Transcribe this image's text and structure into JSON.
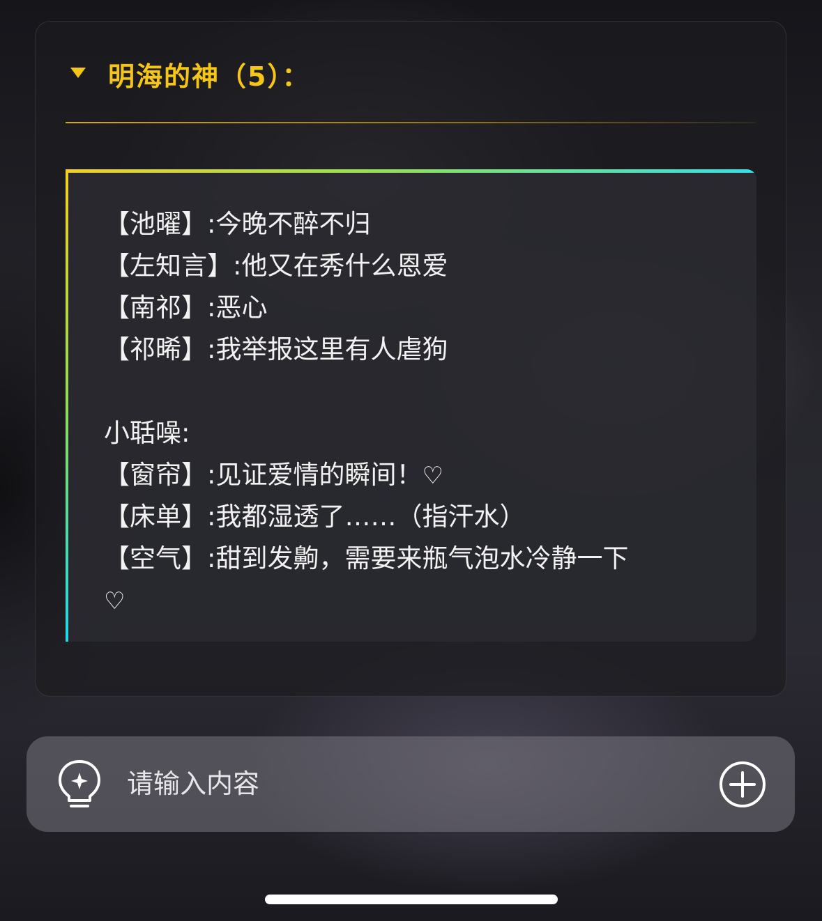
{
  "header": {
    "title": "明海的神（5）："
  },
  "messages": [
    "【池曜】:今晚不醉不归",
    "【左知言】:他又在秀什么恩爱",
    "【南祁】:恶心",
    "【祁晞】:我举报这里有人虐狗",
    "",
    "小聒噪:",
    "【窗帘】:见证爱情的瞬间！",
    "【床单】:我都湿透了……（指汗水）",
    "【空气】:甜到发齁，需要来瓶气泡水冷静一下"
  ],
  "icons": {
    "heart": "♡",
    "caret": "caret-down-icon",
    "bulb": "lightbulb-icon",
    "plus": "plus-circle-icon"
  },
  "input": {
    "placeholder": "请输入内容"
  },
  "colors": {
    "accent": "#f5c518",
    "gradient_start": "#f3cf1e",
    "gradient_end": "#2fe3e8"
  }
}
